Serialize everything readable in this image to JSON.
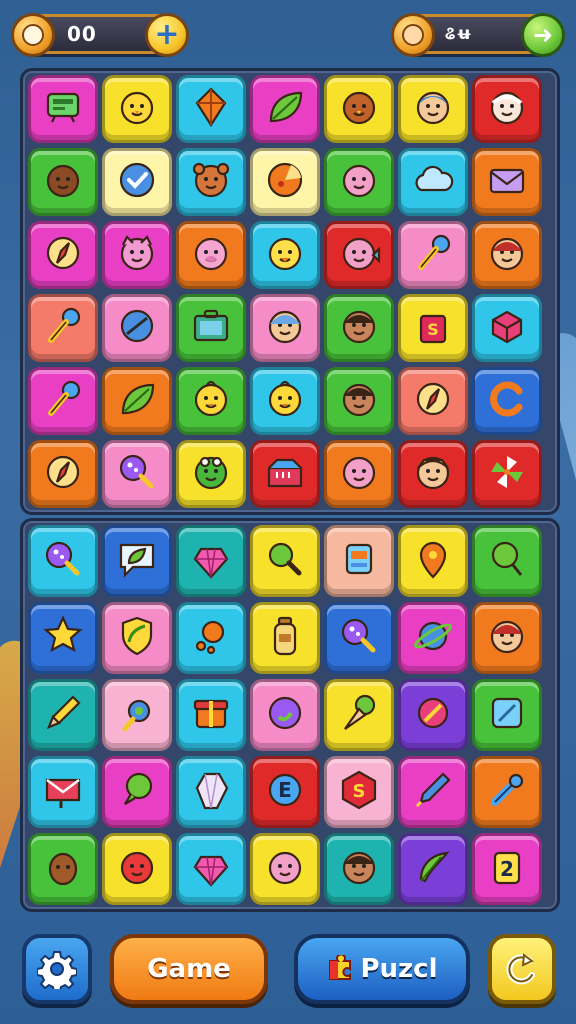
{
  "hud": {
    "coins_value": "00",
    "gems_value": "ଌʉ"
  },
  "colors": {
    "magenta": "#e83fc4",
    "yellow": "#f7e12a",
    "cyan": "#2fc6ea",
    "orange": "#f27a1e",
    "red": "#e02a2a",
    "green": "#48c23a",
    "pink": "#f58cc8",
    "lightpink": "#f9b3d2",
    "blue": "#2e6fd8",
    "purple": "#7b3fd8",
    "teal": "#1fb3b0",
    "peach": "#f7b8a0",
    "salmon": "#f47a6a",
    "lightyellow": "#fff5a8",
    "tan": "#f5c89a"
  },
  "board_top": [
    [
      {
        "c": "magenta",
        "i": "tv-icon"
      },
      {
        "c": "yellow",
        "i": "chick-icon"
      },
      {
        "c": "cyan",
        "i": "kite-icon"
      },
      {
        "c": "magenta",
        "i": "leaf-icon"
      },
      {
        "c": "yellow",
        "i": "bird-icon"
      },
      {
        "c": "yellow",
        "i": "boy-face-icon"
      },
      {
        "c": "red",
        "i": "grandpa-face-icon"
      }
    ],
    [
      {
        "c": "green",
        "i": "face-brown-icon"
      },
      {
        "c": "lightyellow",
        "i": "check-icon"
      },
      {
        "c": "cyan",
        "i": "bear-icon"
      },
      {
        "c": "lightyellow",
        "i": "pizza-icon"
      },
      {
        "c": "green",
        "i": "face-pink-icon"
      },
      {
        "c": "cyan",
        "i": "cloud-icon"
      },
      {
        "c": "orange",
        "i": "envelope-icon"
      }
    ],
    [
      {
        "c": "magenta",
        "i": "compass-icon"
      },
      {
        "c": "magenta",
        "i": "cat-icon"
      },
      {
        "c": "orange",
        "i": "pig-icon"
      },
      {
        "c": "cyan",
        "i": "duck-icon"
      },
      {
        "c": "red",
        "i": "fish-icon"
      },
      {
        "c": "pink",
        "i": "microphone-icon"
      },
      {
        "c": "orange",
        "i": "girl-face-icon"
      }
    ],
    [
      {
        "c": "salmon",
        "i": "microphone-icon"
      },
      {
        "c": "pink",
        "i": "disc-icon"
      },
      {
        "c": "green",
        "i": "briefcase-icon"
      },
      {
        "c": "pink",
        "i": "baby-face-icon"
      },
      {
        "c": "green",
        "i": "kid-face-icon"
      },
      {
        "c": "yellow",
        "i": "bag-icon"
      },
      {
        "c": "cyan",
        "i": "box-icon"
      }
    ],
    [
      {
        "c": "magenta",
        "i": "microphone-icon"
      },
      {
        "c": "orange",
        "i": "leaf-icon"
      },
      {
        "c": "green",
        "i": "duckling-icon"
      },
      {
        "c": "cyan",
        "i": "duckling-icon"
      },
      {
        "c": "green",
        "i": "kid-face-icon"
      },
      {
        "c": "salmon",
        "i": "compass-icon"
      },
      {
        "c": "blue",
        "i": "letter-c-icon"
      }
    ],
    [
      {
        "c": "orange",
        "i": "compass-icon"
      },
      {
        "c": "pink",
        "i": "lollipop-icon"
      },
      {
        "c": "yellow",
        "i": "frog-icon"
      },
      {
        "c": "red",
        "i": "toolbox-icon"
      },
      {
        "c": "orange",
        "i": "face-pink-icon"
      },
      {
        "c": "red",
        "i": "elf-face-icon"
      },
      {
        "c": "red",
        "i": "pinwheel-icon"
      }
    ]
  ],
  "board_bottom": [
    [
      {
        "c": "cyan",
        "i": "lollipop-icon"
      },
      {
        "c": "blue",
        "i": "chat-leaf-icon"
      },
      {
        "c": "teal",
        "i": "gem-icon"
      },
      {
        "c": "yellow",
        "i": "magnifier-icon"
      },
      {
        "c": "peach",
        "i": "robot-icon"
      },
      {
        "c": "yellow",
        "i": "map-pin-icon"
      },
      {
        "c": "green",
        "i": "balloon-icon"
      }
    ],
    [
      {
        "c": "blue",
        "i": "star-icon"
      },
      {
        "c": "pink",
        "i": "shield-leaf-icon"
      },
      {
        "c": "cyan",
        "i": "orange-fruit-icon"
      },
      {
        "c": "yellow",
        "i": "bottle-icon"
      },
      {
        "c": "blue",
        "i": "lollipop-icon"
      },
      {
        "c": "magenta",
        "i": "planet-icon"
      },
      {
        "c": "orange",
        "i": "girl-face-icon"
      }
    ],
    [
      {
        "c": "teal",
        "i": "pencil-icon"
      },
      {
        "c": "lightpink",
        "i": "gear-bug-icon"
      },
      {
        "c": "cyan",
        "i": "gift-icon"
      },
      {
        "c": "pink",
        "i": "orb-icon"
      },
      {
        "c": "yellow",
        "i": "ice-cream-icon"
      },
      {
        "c": "purple",
        "i": "badge-icon"
      },
      {
        "c": "green",
        "i": "frame-icon"
      }
    ],
    [
      {
        "c": "cyan",
        "i": "mailbox-icon"
      },
      {
        "c": "magenta",
        "i": "speech-green-icon"
      },
      {
        "c": "cyan",
        "i": "crystal-icon"
      },
      {
        "c": "red",
        "i": "letter-e-icon"
      },
      {
        "c": "lightpink",
        "i": "hexagon-s-icon"
      },
      {
        "c": "magenta",
        "i": "pen-icon"
      },
      {
        "c": "orange",
        "i": "wrench-icon"
      }
    ],
    [
      {
        "c": "green",
        "i": "egg-brown-icon"
      },
      {
        "c": "yellow",
        "i": "red-ball-face-icon"
      },
      {
        "c": "cyan",
        "i": "gem-icon"
      },
      {
        "c": "yellow",
        "i": "face-pink-icon"
      },
      {
        "c": "teal",
        "i": "kid-face-icon"
      },
      {
        "c": "purple",
        "i": "feather-icon"
      },
      {
        "c": "magenta",
        "i": "number-2-icon"
      }
    ]
  ],
  "bottom_bar": {
    "game_label": "Game",
    "puzzle_label": "Puzcl"
  }
}
